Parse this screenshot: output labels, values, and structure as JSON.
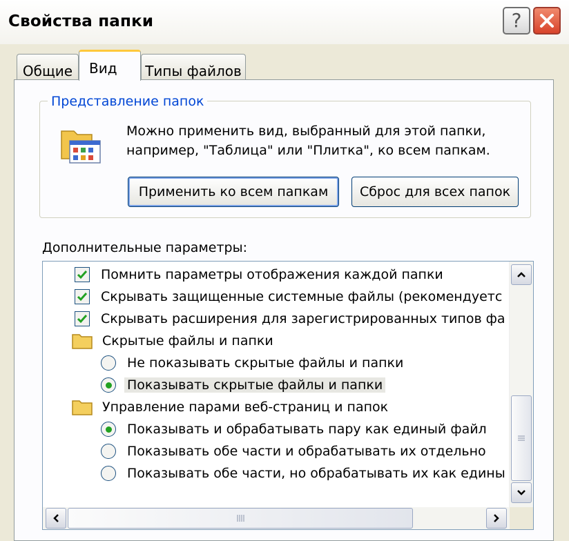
{
  "window": {
    "title": "Свойства папки"
  },
  "tabs": [
    {
      "label": "Общие",
      "active": false
    },
    {
      "label": "Вид",
      "active": true
    },
    {
      "label": "Типы файлов",
      "active": false
    }
  ],
  "folder_views": {
    "title": "Представление папок",
    "description_line1": "Можно применить вид, выбранный для этой папки,",
    "description_line2": "например, \"Таблица\" или \"Плитка\", ко всем папкам.",
    "apply_button": "Применить ко всем папкам",
    "reset_button": "Сброс для всех папок"
  },
  "advanced": {
    "label": "Дополнительные параметры:",
    "items": [
      {
        "type": "checkbox",
        "checked": true,
        "label": "Помнить параметры отображения каждой папки"
      },
      {
        "type": "checkbox",
        "checked": true,
        "label": "Скрывать защищенные системные файлы (рекомендуетс"
      },
      {
        "type": "checkbox",
        "checked": true,
        "label": "Скрывать расширения для зарегистрированных типов фа"
      },
      {
        "type": "folder",
        "label": "Скрытые файлы и папки"
      },
      {
        "type": "radio",
        "checked": false,
        "label": "Не показывать скрытые файлы и папки"
      },
      {
        "type": "radio",
        "checked": true,
        "selected": true,
        "label": "Показывать скрытые файлы и папки"
      },
      {
        "type": "folder",
        "label": "Управление парами веб-страниц и папок"
      },
      {
        "type": "radio",
        "checked": true,
        "label": "Показывать и обрабатывать пару как единый файл"
      },
      {
        "type": "radio",
        "checked": false,
        "label": "Показывать обе части и обрабатывать их отдельно"
      },
      {
        "type": "radio",
        "checked": false,
        "label": "Показывать обе части, но обрабатывать их как едины"
      }
    ]
  },
  "icons": {
    "help": "help-icon",
    "close": "close-icon",
    "folder_view": "folder-view-icon",
    "folder": "folder-icon",
    "check": "checkmark-icon",
    "scroll_up": "chevron-up-icon",
    "scroll_down": "chevron-down-icon",
    "scroll_left": "chevron-left-icon",
    "scroll_right": "chevron-right-icon"
  },
  "colors": {
    "group_title": "#0046d5",
    "check": "#21a121",
    "close_button": "#d8432b",
    "active_tab_highlight": "#ffc83c"
  }
}
